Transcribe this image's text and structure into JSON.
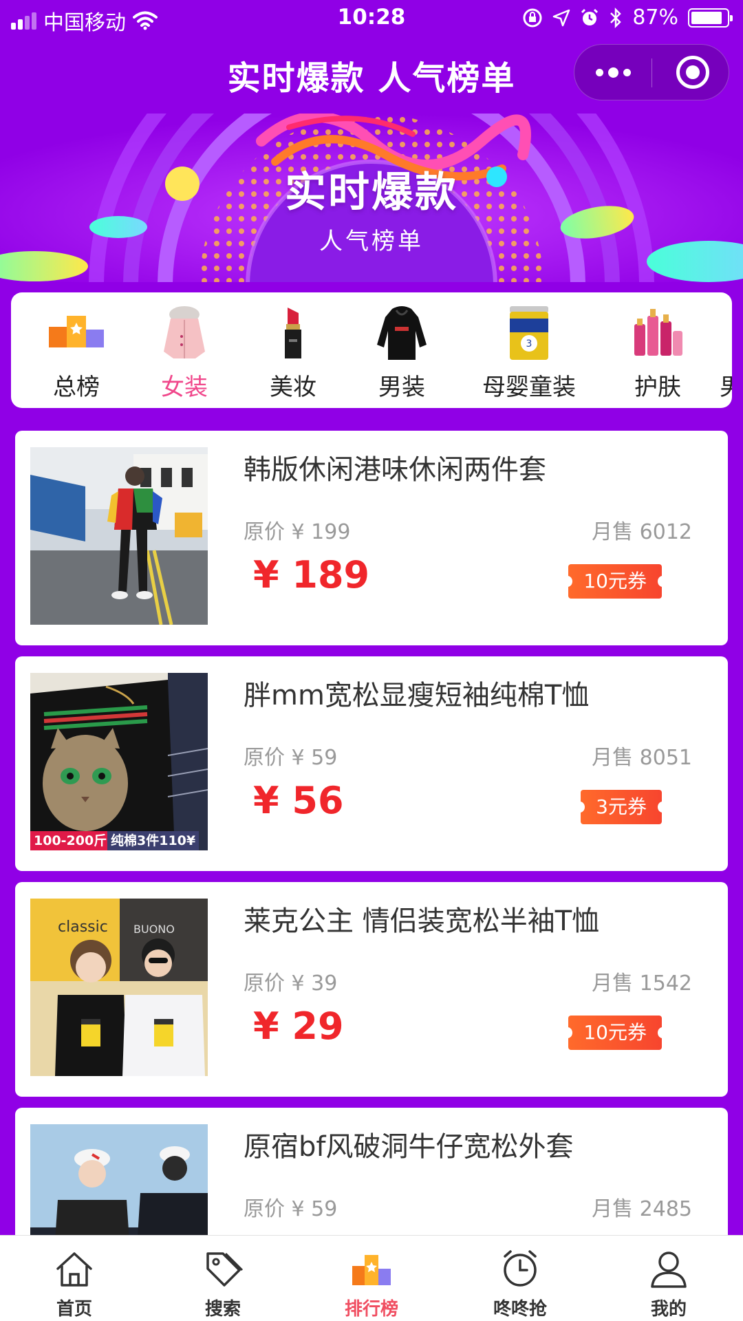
{
  "status_bar": {
    "carrier": "中国移动",
    "time": "10:28",
    "battery": "87%",
    "battery_level": 0.87
  },
  "nav": {
    "title": "实时爆款 人气榜单"
  },
  "banner": {
    "title": "实时爆款",
    "subtitle": "人气榜单"
  },
  "categories": [
    {
      "label": "总榜",
      "active": false
    },
    {
      "label": "女装",
      "active": true
    },
    {
      "label": "美妆",
      "active": false
    },
    {
      "label": "男装",
      "active": false
    },
    {
      "label": "母婴童装",
      "active": false
    },
    {
      "label": "护肤",
      "active": false
    },
    {
      "label": "男",
      "active": false
    }
  ],
  "products": [
    {
      "name": "韩版休闲港味休闲两件套",
      "original_price": "原价 ¥ 199",
      "monthly_sales": "月售 6012",
      "price": "¥ 189",
      "coupon": "10元券",
      "thumb_tags": []
    },
    {
      "name": "胖mm宽松显瘦短袖纯棉T恤",
      "original_price": "原价 ¥ 59",
      "monthly_sales": "月售 8051",
      "price": "¥ 56",
      "coupon": "3元券",
      "thumb_tags": [
        "100-200斤",
        "纯棉3件110¥"
      ]
    },
    {
      "name": "莱克公主 情侣装宽松半袖T恤",
      "original_price": "原价 ¥ 39",
      "monthly_sales": "月售 1542",
      "price": "¥ 29",
      "coupon": "10元券",
      "thumb_tags": []
    },
    {
      "name": "原宿bf风破洞牛仔宽松外套",
      "original_price": "原价 ¥ 59",
      "monthly_sales": "月售 2485",
      "price": "",
      "coupon": "",
      "thumb_tags": []
    }
  ],
  "tabs": [
    {
      "label": "首页",
      "icon": "home-icon",
      "active": false
    },
    {
      "label": "搜索",
      "icon": "tag-icon",
      "active": false
    },
    {
      "label": "排行榜",
      "icon": "ranking-icon",
      "active": true
    },
    {
      "label": "咚咚抢",
      "icon": "alarm-clock-icon",
      "active": false
    },
    {
      "label": "我的",
      "icon": "user-icon",
      "active": false
    }
  ],
  "colors": {
    "page_background": "#9000e6",
    "price_red": "#f0262b",
    "coupon_orange": "#f7452e",
    "active_category": "#f0478b",
    "active_tab": "#f04e61"
  }
}
